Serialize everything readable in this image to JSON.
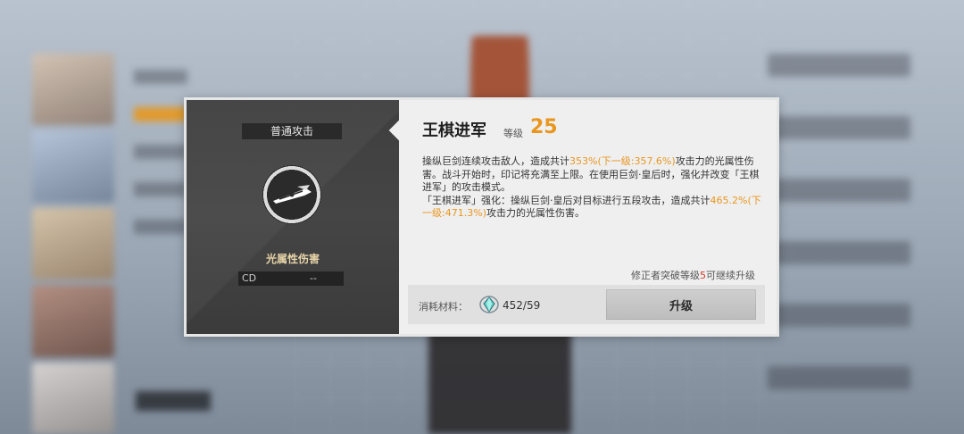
{
  "skill": {
    "attack_type": "普通攻击",
    "element": "光属性伤害",
    "cd_label": "CD",
    "cd_value": "--",
    "name": "王棋进军",
    "level_label": "等级",
    "level": "25",
    "description": {
      "p1_a": "操纵巨剑连续攻击敌人，造成共计",
      "p1_hl": "353%(下一级:357.6%)",
      "p1_b": "攻击力的光属性伤害。战斗开始时，印记将充满至上限。在使用巨剑·皇后时，强化并改变「王棋进军」的攻击模式。",
      "p2_a": "「王棋进军」强化：操纵巨剑·皇后对目标进行五段攻击，造成共计",
      "p2_hl": "465.2%(下一级:471.3%)",
      "p2_b": "攻击力的光属性伤害。"
    }
  },
  "upgrade_req": {
    "prefix": "修正者突破等级",
    "level": "5",
    "suffix": "可继续升级"
  },
  "cost": {
    "label": "消耗材料：",
    "material_icon": "crystal-material-icon",
    "count": "452/59"
  },
  "actions": {
    "upgrade_label": "升级"
  },
  "colors": {
    "accent": "#e9961f",
    "warning": "#d43a2a",
    "panel_dark": "#3f3f3f"
  }
}
